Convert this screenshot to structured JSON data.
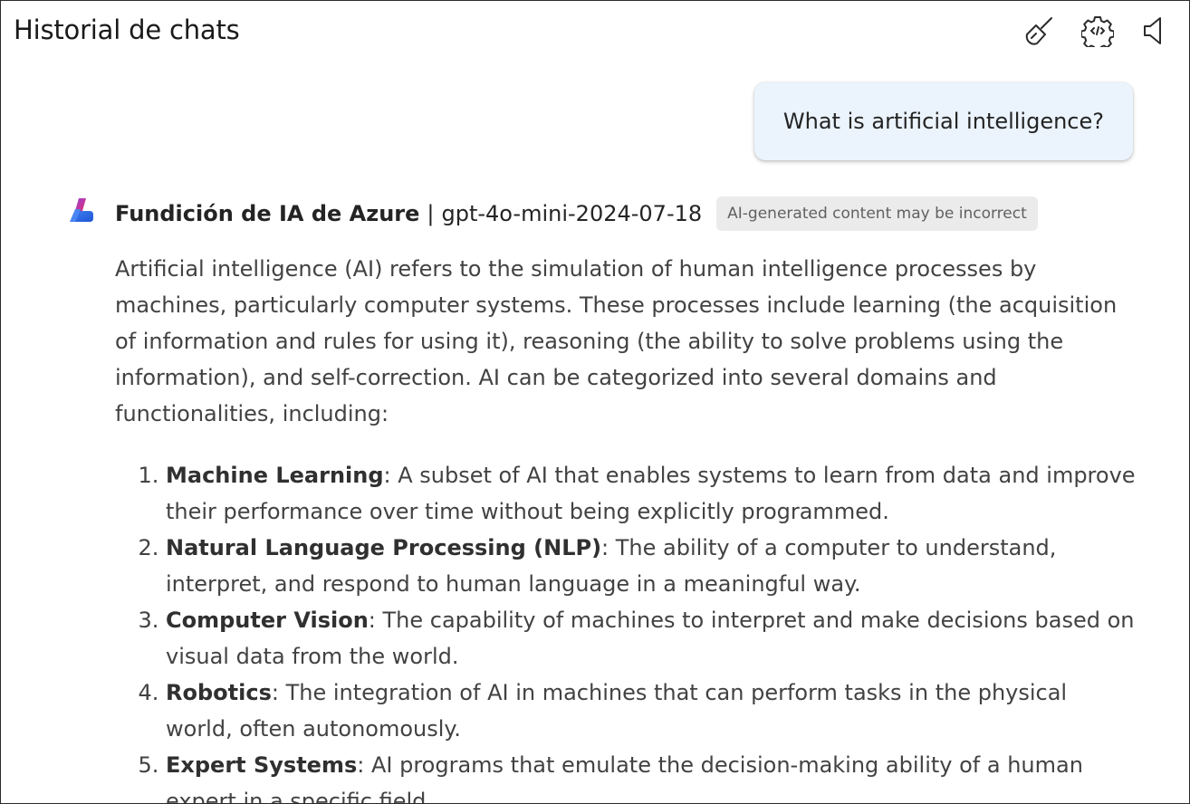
{
  "header": {
    "title": "Historial de chats",
    "actions": [
      {
        "icon": "broom-icon",
        "name": "clear-chat-button"
      },
      {
        "icon": "settings-icon",
        "name": "settings-button"
      },
      {
        "icon": "speaker-icon",
        "name": "speaker-button"
      }
    ]
  },
  "user_message": {
    "text": "What is artificial intelligence?"
  },
  "assistant": {
    "source": "Fundición de IA de Azure",
    "separator": "|",
    "model": "gpt-4o-mini-2024-07-18",
    "badge": "AI-generated content may be incorrect",
    "intro": "Artificial intelligence (AI) refers to the simulation of human intelligence processes by machines, particularly computer systems. These processes include learning (the acquisition of information and rules for using it), reasoning (the ability to solve problems using the information), and self-correction. AI can be categorized into several domains and functionalities, including:",
    "items": [
      {
        "term": "Machine Learning",
        "desc": ": A subset of AI that enables systems to learn from data and improve their performance over time without being explicitly programmed."
      },
      {
        "term": "Natural Language Processing (NLP)",
        "desc": ": The ability of a computer to understand, interpret, and respond to human language in a meaningful way."
      },
      {
        "term": "Computer Vision",
        "desc": ": The capability of machines to interpret and make decisions based on visual data from the world."
      },
      {
        "term": "Robotics",
        "desc": ": The integration of AI in machines that can perform tasks in the physical world, often autonomously."
      },
      {
        "term": "Expert Systems",
        "desc": ": AI programs that emulate the decision-making ability of a human expert in a specific field."
      }
    ]
  },
  "colors": {
    "user_bubble": "#ebf3fc",
    "badge_bg": "#ebebeb",
    "logo_primary": "#2f6fe4",
    "logo_accent": "#c03bc4"
  }
}
